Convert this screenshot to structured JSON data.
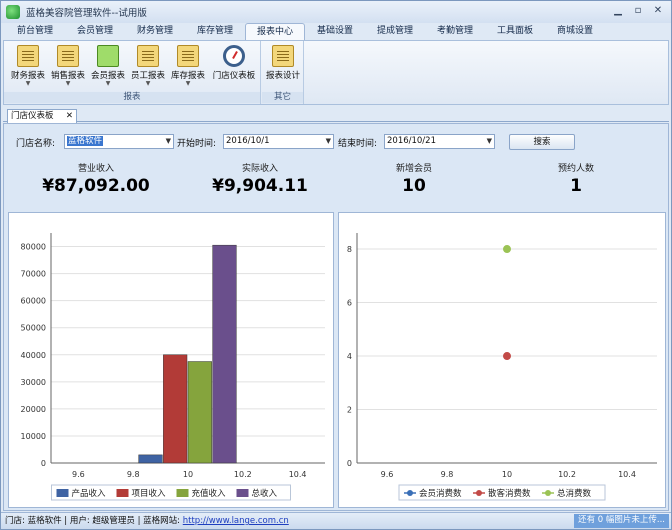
{
  "window": {
    "title": "蓝格美容院管理软件--试用版"
  },
  "ribbon_tabs": [
    "前台管理",
    "会员管理",
    "财务管理",
    "库存管理",
    "报表中心",
    "基础设置",
    "提成管理",
    "考勤管理",
    "工具面板",
    "商城设置"
  ],
  "active_tab": "报表中心",
  "ribbon_groups": {
    "reports": {
      "label": "报表",
      "buttons": [
        "财务报表",
        "销售报表",
        "会员报表",
        "员工报表",
        "库存报表",
        "门店仪表板"
      ]
    },
    "other": {
      "label": "其它",
      "buttons": [
        "报表设计"
      ]
    }
  },
  "doc_tab": {
    "label": "门店仪表板",
    "close": "✕"
  },
  "filters": {
    "store_label": "门店名称:",
    "store_value": "蓝格软件",
    "start_label": "开始时间:",
    "start_value": "2016/10/1",
    "end_label": "结束时间:",
    "end_value": "2016/10/21",
    "search_label": "搜索"
  },
  "stats": [
    {
      "label": "营业收入",
      "value": "¥87,092.00"
    },
    {
      "label": "实际收入",
      "value": "¥9,904.11"
    },
    {
      "label": "新增会员",
      "value": "10"
    },
    {
      "label": "预约人数",
      "value": "1"
    }
  ],
  "chart_data": [
    {
      "type": "bar",
      "title": "",
      "xlabel": "",
      "ylabel": "",
      "xlim": [
        9.5,
        10.5
      ],
      "ylim": [
        0,
        85000
      ],
      "x_ticks": [
        "9.6",
        "9.8",
        "10",
        "10.2",
        "10.4"
      ],
      "y_ticks": [
        "0",
        "10000",
        "20000",
        "30000",
        "40000",
        "50000",
        "60000",
        "70000",
        "80000"
      ],
      "x": [
        10
      ],
      "series": [
        {
          "name": "产品收入",
          "values": [
            3000
          ],
          "color": "#3f63a3"
        },
        {
          "name": "项目收入",
          "values": [
            40000
          ],
          "color": "#b23b37"
        },
        {
          "name": "充值收入",
          "values": [
            37500
          ],
          "color": "#85a43d"
        },
        {
          "name": "总收入",
          "values": [
            80500
          ],
          "color": "#6a4f8c"
        }
      ],
      "legend": "bottom",
      "grid": true
    },
    {
      "type": "scatter",
      "title": "",
      "xlabel": "",
      "ylabel": "",
      "xlim": [
        9.5,
        10.5
      ],
      "ylim": [
        0,
        8.6
      ],
      "x_ticks": [
        "9.6",
        "9.8",
        "10",
        "10.2",
        "10.4"
      ],
      "y_ticks": [
        "0",
        "2",
        "4",
        "6",
        "8"
      ],
      "series": [
        {
          "name": "会员消费数",
          "x": [
            10
          ],
          "values": [
            null
          ],
          "color": "#3a6fb7"
        },
        {
          "name": "散客消费数",
          "x": [
            10
          ],
          "values": [
            4
          ],
          "color": "#c24a47"
        },
        {
          "name": "总消费数",
          "x": [
            10
          ],
          "values": [
            8
          ],
          "color": "#9bc355"
        }
      ],
      "legend": "bottom",
      "grid": true
    }
  ],
  "statusbar": {
    "store": "门店: 蓝格软件 | 用户: 超级管理员 | 蓝格网站:",
    "url": "http://www.lange.com.cn",
    "upload": "还有 0 幅图片未上传..."
  }
}
